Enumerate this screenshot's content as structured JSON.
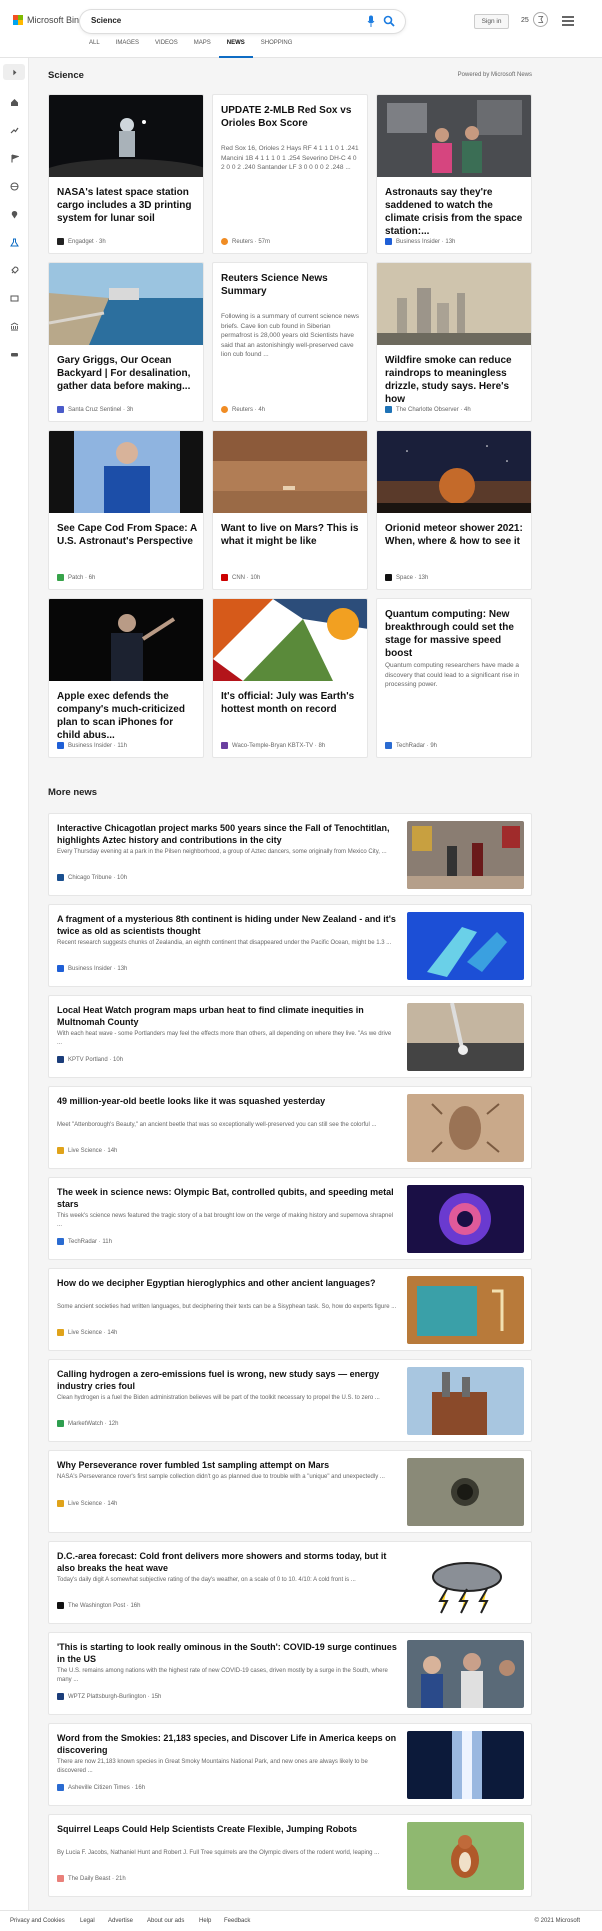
{
  "header": {
    "logo_text": "Microsoft Bing",
    "search_value": "Science",
    "signin_label": "Sign in",
    "rewards_count": "25",
    "tabs": [
      {
        "label": "ALL"
      },
      {
        "label": "IMAGES"
      },
      {
        "label": "VIDEOS"
      },
      {
        "label": "MAPS"
      },
      {
        "label": "NEWS"
      },
      {
        "label": "SHOPPING"
      }
    ],
    "active_tab": "NEWS"
  },
  "section": {
    "title": "Science",
    "powered_by": "Powered by Microsoft News"
  },
  "cards": [
    {
      "title": "NASA's latest space station cargo includes a 3D printing system for lunar soil",
      "snippet": "",
      "source": "Engadget · 3h",
      "source_color": "#222222",
      "image": "astronaut-night"
    },
    {
      "title": "UPDATE 2-MLB Red Sox vs Orioles Box Score",
      "snippet": "Red Sox 16, Orioles 2 Hays RF 4 1 1 1 0 1 .241 Mancini 1B 4 1 1 1 0 1 .254 Severino DH-C 4 0 2 0 0 2 .240 Santander LF 3 0 0 0 0 2 .248 ...",
      "source": "Reuters · 57m",
      "source_color": "#f08c24",
      "image": ""
    },
    {
      "title": "Astronauts say they're saddened to watch the climate crisis from the space station:...",
      "snippet": "",
      "source": "Business Insider · 13h",
      "source_color": "#1f5fd6",
      "image": "space-station"
    },
    {
      "title": "Gary Griggs, Our Ocean Backyard | For desalination, gather data before making...",
      "snippet": "",
      "source": "Santa Cruz Sentinel · 3h",
      "source_color": "#4a5bc9",
      "image": "coast"
    },
    {
      "title": "Reuters Science News Summary",
      "snippet": "Following is a summary of current science news briefs. Cave lion cub found in Siberian permafrost is 28,000 years old Scientists have said that an astonishingly well-preserved cave lion cub found ...",
      "source": "Reuters · 4h",
      "source_color": "#f08c24",
      "image": ""
    },
    {
      "title": "Wildfire smoke can reduce raindrops to meaningless drizzle, study says. Here's how",
      "snippet": "",
      "source": "The Charlotte Observer · 4h",
      "source_color": "#1f73b7",
      "image": "smoke"
    },
    {
      "title": "See Cape Cod From Space: A U.S. Astronaut's Perspective",
      "snippet": "",
      "source": "Patch · 6h",
      "source_color": "#37a34a",
      "image": "astronaut-blue"
    },
    {
      "title": "Want to live on Mars? This is what it might be like",
      "snippet": "",
      "source": "CNN · 10h",
      "source_color": "#cc0000",
      "image": "mars"
    },
    {
      "title": "Orionid meteor shower 2021: When, where & how to see it",
      "snippet": "",
      "source": "Space · 13h",
      "source_color": "#111111",
      "image": "meteor"
    },
    {
      "title": "Apple exec defends the company's much-criticized plan to scan iPhones for child abus...",
      "snippet": "",
      "source": "Business Insider · 11h",
      "source_color": "#1f5fd6",
      "image": "apple-exec"
    },
    {
      "title": "It's official: July was Earth's hottest month on record",
      "snippet": "",
      "source": "Waco-Temple-Bryan KBTX-TV · 8h",
      "source_color": "#6a3fa0",
      "image": "collage"
    },
    {
      "title": "Quantum computing: New breakthrough could set the stage for massive speed boost",
      "snippet": "Quantum computing researchers have made a discovery that could lead to a significant rise in processing power.",
      "source": "TechRadar · 9h",
      "source_color": "#2a6bd1",
      "image": ""
    }
  ],
  "more_news": {
    "title": "More news",
    "items": [
      {
        "title": "Interactive Chicagotlan project marks 500 years since the Fall of Tenochtitlan, highlights Aztec history and contributions in the city",
        "snippet": "Every Thursday evening at a park in the Pilsen neighborhood, a group of Aztec dancers, some originally from Mexico City, ...",
        "source": "Chicago Tribune · 10h",
        "source_color": "#1a4f8f",
        "image": "gallery"
      },
      {
        "title": "A fragment of a mysterious 8th continent is hiding under New Zealand - and it's twice as old as scientists thought",
        "snippet": "Recent research suggests chunks of Zealandia, an eighth continent that disappeared under the Pacific Ocean, might be 1.3 ...",
        "source": "Business Insider · 13h",
        "source_color": "#1f5fd6",
        "image": "zealandia"
      },
      {
        "title": "Local Heat Watch program maps urban heat to find climate inequities in Multnomah County",
        "snippet": "With each heat wave - some Portlanders may feel the effects more than others, all depending on where they live. \"As we drive ...",
        "source": "KPTV Portland · 10h",
        "source_color": "#1b3d7a",
        "image": "sensor"
      },
      {
        "title": "49 million-year-old beetle looks like it was squashed yesterday",
        "snippet": "Meet \"Attenborough's Beauty,\" an ancient beetle that was so exceptionally well-preserved you can still see the colorful ...",
        "source": "Live Science · 14h",
        "source_color": "#e0a31a",
        "image": "fossil"
      },
      {
        "title": "The week in science news: Olympic Bat, controlled qubits, and speeding metal stars",
        "snippet": "This week's science news featured the tragic story of a bat brought low on the verge of making history and supernova shrapnel ...",
        "source": "TechRadar · 11h",
        "source_color": "#2a6bd1",
        "image": "nebula"
      },
      {
        "title": "How do we decipher Egyptian hieroglyphics and other ancient languages?",
        "snippet": "Some ancient societies had written languages, but deciphering their texts can be a Sisyphean task. So, how do experts figure ...",
        "source": "Live Science · 14h",
        "source_color": "#e0a31a",
        "image": "hieroglyph"
      },
      {
        "title": "Calling hydrogen a zero-emissions fuel is wrong, new study says — energy industry cries foul",
        "snippet": "Clean hydrogen is a fuel the Biden administration believes will be part of the toolkit necessary to propel the U.S. to zero ...",
        "source": "MarketWatch · 12h",
        "source_color": "#2e9e4f",
        "image": "plant"
      },
      {
        "title": "Why Perseverance rover fumbled 1st sampling attempt on Mars",
        "snippet": "NASA's Perseverance rover's first sample collection didn't go as planned due to trouble with a \"unique\" and unexpectedly ...",
        "source": "Live Science · 14h",
        "source_color": "#e0a31a",
        "image": "hole"
      },
      {
        "title": "D.C.-area forecast: Cold front delivers more showers and storms today, but it also breaks the heat wave",
        "snippet": "Today's daily digit A somewhat subjective rating of the day's weather, on a scale of 0 to 10. 4/10: A cold front is ...",
        "source": "The Washington Post · 16h",
        "source_color": "#111111",
        "image": "storm"
      },
      {
        "title": "'This is starting to look really ominous in the South': COVID-19 surge continues in the US",
        "snippet": "The U.S. remains among nations with the highest rate of new COVID-19 cases, driven mostly by a surge in the South, where many ...",
        "source": "WPTZ Plattsburgh-Burlington · 15h",
        "source_color": "#1b3d7a",
        "image": "covid"
      },
      {
        "title": "Word from the Smokies: 21,183 species, and Discover Life in America keeps on discovering",
        "snippet": "There are now 21,183 known species in Great Smoky Mountains National Park, and new ones are always likely to be discovered ...",
        "source": "Asheville Citizen Times · 16h",
        "source_color": "#2a6bd1",
        "image": "lab"
      },
      {
        "title": "Squirrel Leaps Could Help Scientists Create Flexible, Jumping Robots",
        "snippet": "By Lucia F. Jacobs, Nathaniel Hunt and Robert J. Full Tree squirrels are the Olympic divers of the rodent world, leaping ...",
        "source": "The Daily Beast · 21h",
        "source_color": "#e9807a",
        "image": "squirrel"
      }
    ]
  },
  "footer": {
    "links": [
      {
        "label": "Privacy and Cookies"
      },
      {
        "label": "Legal"
      },
      {
        "label": "Advertise"
      },
      {
        "label": "About our ads"
      },
      {
        "label": "Help"
      },
      {
        "label": "Feedback"
      }
    ],
    "copyright": "© 2021 Microsoft"
  },
  "sidebar": {
    "icons": [
      "expand-icon",
      "home-icon",
      "trending-icon",
      "flag-icon",
      "globe-icon",
      "location-icon",
      "science-icon",
      "rocket-icon",
      "entertainment-icon",
      "money-icon",
      "car-icon"
    ]
  }
}
